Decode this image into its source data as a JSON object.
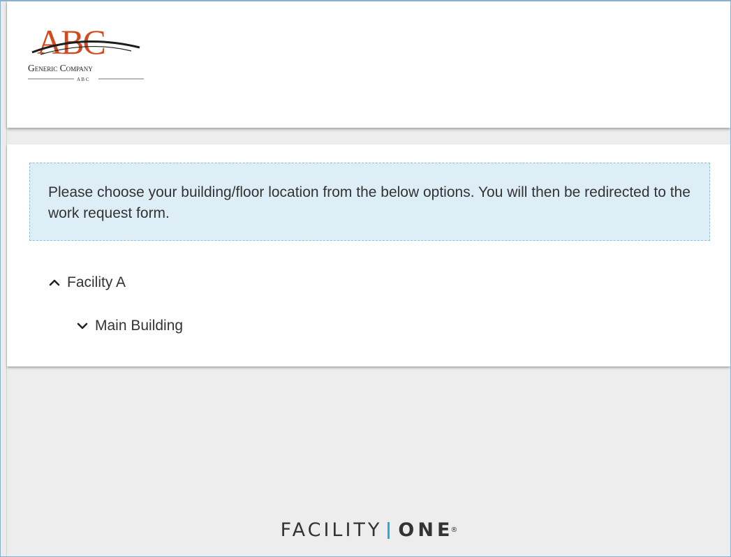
{
  "header": {
    "logo": {
      "icon": "abc-company-logo",
      "mark": "ABC",
      "company": "Generic Company",
      "sub": "A B C"
    }
  },
  "main": {
    "instruction": "Please choose your building/floor location from the below options. You will then be redirected to the work request form.",
    "tree": [
      {
        "label": "Facility A",
        "icon": "chevron-up-icon",
        "expanded": true
      },
      {
        "label": "Main Building",
        "icon": "chevron-down-icon",
        "expanded": false
      }
    ]
  },
  "footer": {
    "brand_left": "FACILITY",
    "brand_right": "ONE",
    "registered": "®",
    "accent_color": "#29a9e0"
  },
  "colors": {
    "info_box_bg": "#ddeef6",
    "info_box_border": "#8fc0d6",
    "logo_red": "#d24a1e",
    "text": "#333333",
    "page_bg": "#ededed"
  }
}
